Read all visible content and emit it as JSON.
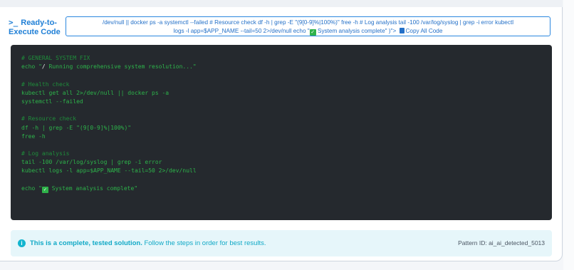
{
  "header": {
    "title_line1": "Ready-to-",
    "title_line2": "Execute Code",
    "copy_button": {
      "line1": "/dev/null || docker ps -a systemctl --failed # Resource check df -h | grep -E \"(9[0-9]%|100%)\" free -h # Log analysis tail -100 /var/log/syslog | grep -i error kubectl",
      "line2_pre": "logs -l app=$APP_NAME --tail=50 2>/dev/null echo \"",
      "line2_mid": " System analysis complete\" )\">",
      "line2_label": "Copy All Code"
    }
  },
  "code": {
    "lines": [
      "# GENERAL SYSTEM FIX",
      "echo \"",
      " Running comprehensive system resolution...\"",
      "",
      "# Health check",
      "kubectl get all 2>/dev/null || docker ps -a",
      "systemctl --failed",
      "",
      "# Resource check",
      "df -h | grep -E \"(9[0-9]%|100%)\"",
      "free -h",
      "",
      "# Log analysis",
      "tail -100 /var/log/syslog | grep -i error",
      "kubectl logs -l app=$APP_NAME --tail=50 2>/dev/null",
      "",
      "echo \"",
      " System analysis complete\""
    ]
  },
  "info": {
    "bold": "This is a complete, tested solution.",
    "rest": " Follow the steps in order for best results.",
    "pattern_id": "Pattern ID: ai_ai_detected_5013"
  },
  "colors": {
    "accent": "#1f7fd6",
    "code_bg": "#25292e",
    "code_text": "#2db34a",
    "info_bg": "#e6f6fa",
    "info_text": "#11a9c6"
  },
  "icons": [
    "terminal-prompt-icon",
    "copy-icon",
    "check-icon",
    "pencil-icon",
    "info-icon"
  ]
}
